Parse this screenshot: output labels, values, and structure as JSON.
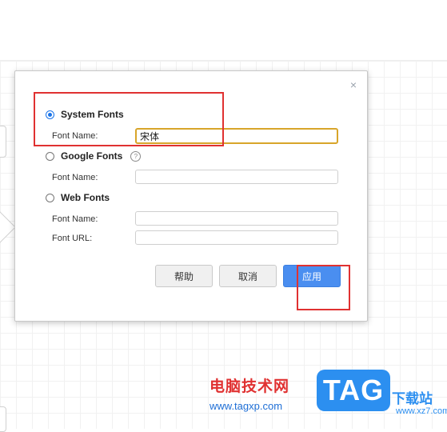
{
  "dialog": {
    "close_glyph": "×",
    "system_fonts": {
      "label": "System Fonts",
      "selected": true,
      "font_name_label": "Font Name:",
      "font_name_value": "宋体"
    },
    "google_fonts": {
      "label": "Google Fonts",
      "selected": false,
      "help_glyph": "?",
      "font_name_label": "Font Name:",
      "font_name_value": ""
    },
    "web_fonts": {
      "label": "Web Fonts",
      "selected": false,
      "font_name_label": "Font Name:",
      "font_name_value": "",
      "font_url_label": "Font URL:",
      "font_url_value": ""
    },
    "buttons": {
      "help": "帮助",
      "cancel": "取消",
      "apply": "应用"
    }
  },
  "watermark": {
    "site_name": "电脑技术网",
    "url": "www.tagxp.com",
    "logo": "TAG",
    "download_label": "下载站",
    "download_site": "www.xz7.com"
  },
  "colors": {
    "accent": "#4a8ef0",
    "highlight": "#e03131",
    "focus": "#d8a52a"
  }
}
